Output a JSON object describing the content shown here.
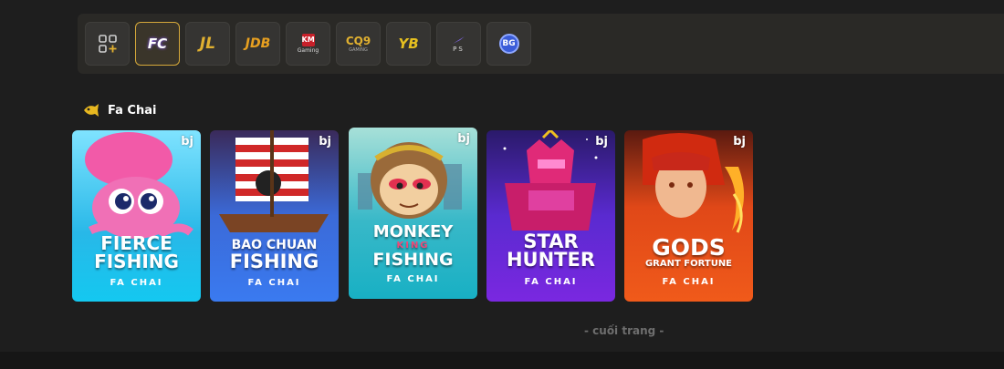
{
  "providers": [
    {
      "name": "all-games",
      "label": ""
    },
    {
      "name": "fc",
      "label": "FC"
    },
    {
      "name": "jl",
      "label": "JL"
    },
    {
      "name": "jdb",
      "label": "JDB"
    },
    {
      "name": "km",
      "label": "KM",
      "sub": "Gaming"
    },
    {
      "name": "cq9",
      "label": "CQ9",
      "sub": "GAMING"
    },
    {
      "name": "yb",
      "label": "YB"
    },
    {
      "name": "ps",
      "label": "PS"
    },
    {
      "name": "bg",
      "label": "BG"
    }
  ],
  "section": {
    "title": "Fa Chai"
  },
  "games": [
    {
      "line1": "FIERCE",
      "line2": "FISHING",
      "line3": "",
      "provider": "FA CHAI",
      "badge": "bj"
    },
    {
      "line1": "BAO CHUAN",
      "line2": "FISHING",
      "line3": "",
      "provider": "FA CHAI",
      "badge": "bj"
    },
    {
      "line1": "MONKEY",
      "line2": "KING",
      "line3": "FISHING",
      "provider": "FA CHAI",
      "badge": "bj"
    },
    {
      "line1": "STAR",
      "line2": "HUNTER",
      "line3": "",
      "provider": "FA CHAI",
      "badge": "bj"
    },
    {
      "line1": "GODS",
      "line2": "GRANT FORTUNE",
      "line3": "",
      "provider": "FA CHAI",
      "badge": "bj"
    }
  ],
  "footer": {
    "text": "- cuối trang -"
  },
  "colors": {
    "accent": "#d6a93a",
    "background": "#1e1e1e",
    "bar": "#2a2926"
  }
}
